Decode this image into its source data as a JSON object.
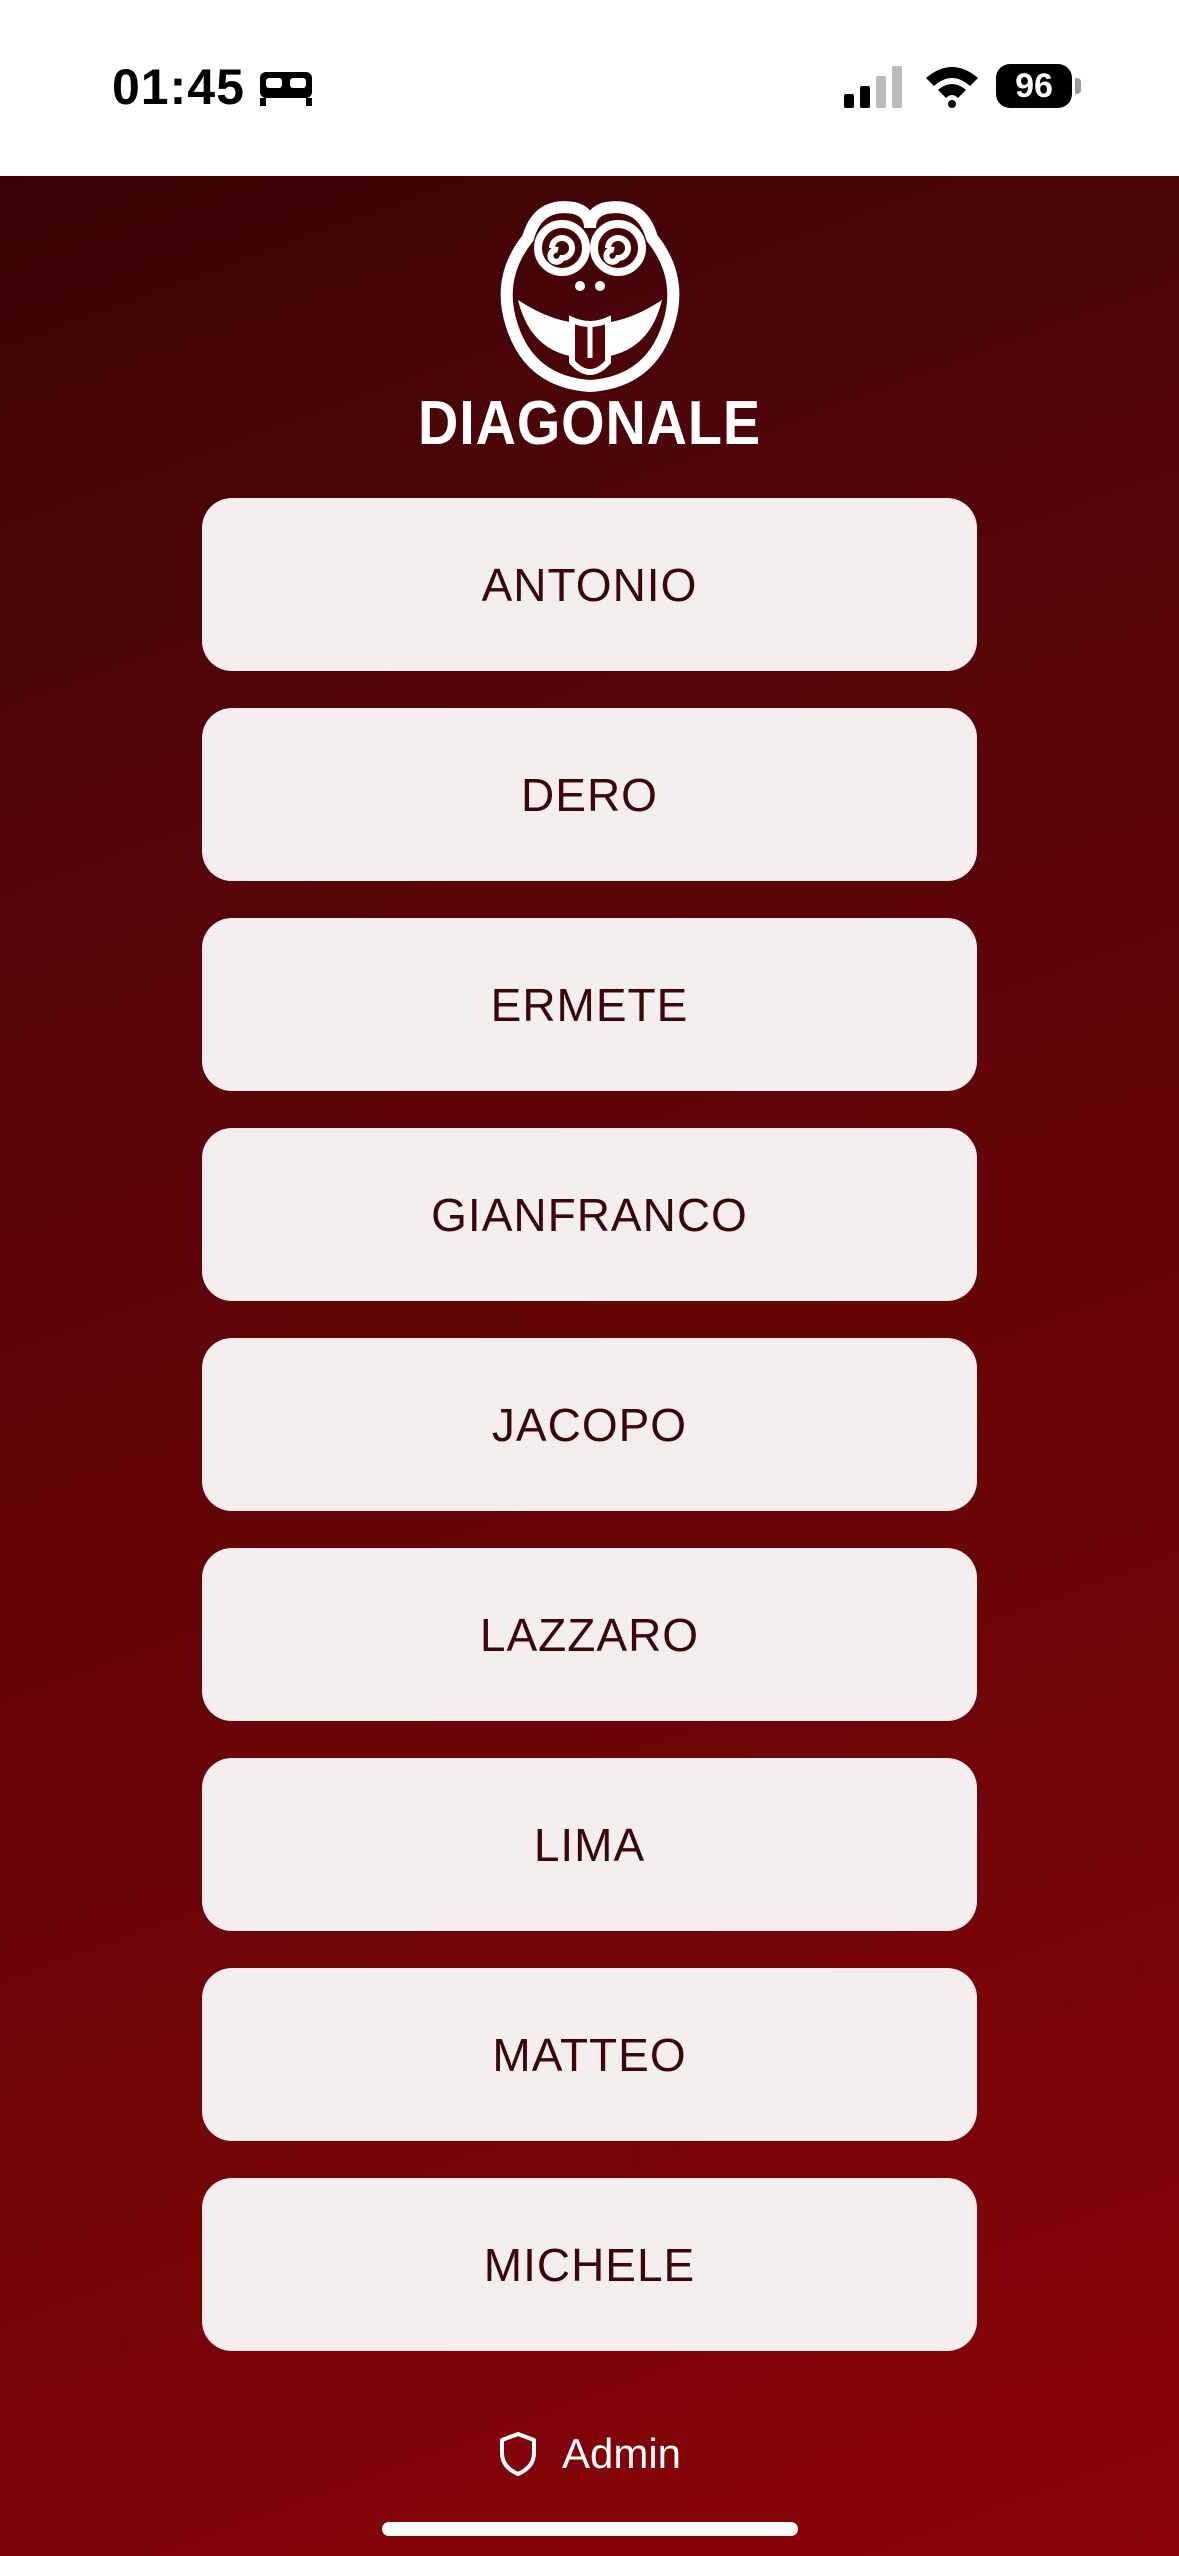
{
  "status_bar": {
    "time": "01:45",
    "battery": "96"
  },
  "logo": {
    "text": "DIAGONALE"
  },
  "names": [
    {
      "label": "ANTONIO"
    },
    {
      "label": "DERO"
    },
    {
      "label": "ERMETE"
    },
    {
      "label": "GIANFRANCO"
    },
    {
      "label": "JACOPO"
    },
    {
      "label": "LAZZARO"
    },
    {
      "label": "LIMA"
    },
    {
      "label": "MATTEO"
    },
    {
      "label": "MICHELE"
    }
  ],
  "footer": {
    "admin_label": "Admin"
  },
  "colors": {
    "background_start": "#3a0406",
    "background_end": "#8a0409",
    "button_bg": "#f5eeee",
    "button_text": "#3a070b"
  }
}
